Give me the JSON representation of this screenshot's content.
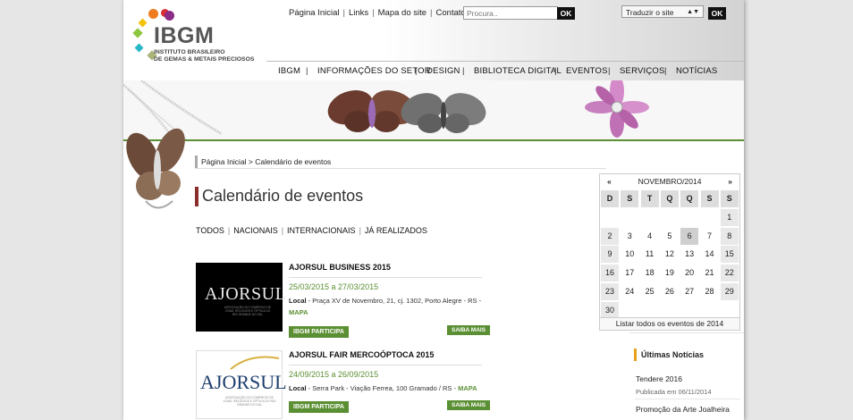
{
  "colors": {
    "brand_green": "#5b8f33",
    "title_accent": "#8a2e2e",
    "news_accent": "#e8a01c"
  },
  "logo": {
    "name": "IBGM",
    "subtitle_line1": "INSTITUTO BRASILEIRO",
    "subtitle_line2": "DE GEMAS & METAIS PRECIOSOS"
  },
  "toplinks": [
    "Página Inicial",
    "Links",
    "Mapa do site",
    "Contato"
  ],
  "search": {
    "placeholder": "Procura..",
    "button": "OK"
  },
  "translate": {
    "value": "Traduzir o site",
    "button": "OK"
  },
  "mainnav": [
    "IBGM",
    "INFORMAÇÕES DO SETOR",
    "DESIGN",
    "BIBLIOTECA DIGITAL",
    "EVENTOS",
    "SERVIÇOS",
    "NOTÍCIAS"
  ],
  "breadcrumb": {
    "home": "Página Inicial",
    "sep": " > ",
    "current": "Calendário de eventos"
  },
  "page_title": "Calendário de eventos",
  "filters": [
    "TODOS",
    "NACIONAIS",
    "INTERNACIONAIS",
    "JÁ REALIZADOS"
  ],
  "events": [
    {
      "title": "AJORSUL BUSINESS 2015",
      "date": "25/03/2015 a 27/03/2015",
      "local_label": "Local",
      "local": " - Praça XV de Novembro, 21, cj. 1302, Porto Alegre - RS - ",
      "map": "MAPA",
      "badge": "IBGM PARTICIPA",
      "more": "SAIBA MAIS",
      "logo_text": "AJORSUL",
      "logo_sub": "ASSOCIAÇÃO DO COMÉRCIO DE JOIAS, RELÓGIOS E ÓPTICA DO RIO GRANDE DO SUL"
    },
    {
      "title": "AJORSUL FAIR MERCOÓPTOCA 2015",
      "date": "24/09/2015 a 26/09/2015",
      "local_label": "Local",
      "local": " - Serra Park - Viação Ferrea, 100 Gramado / RS - ",
      "map": "MAPA",
      "badge": "IBGM PARTICIPA",
      "more": "SAIBA MAIS",
      "logo_text": "AJORSUL",
      "logo_sub": "ASSOCIAÇÃO DO COMÉRCIO DE JOIAS, RELÓGIOS E ÓPTICA DO RIO GRANDE DO SUL"
    }
  ],
  "calendar": {
    "prev": "«",
    "next": "»",
    "month": "NOVEMBRO/2014",
    "weekdays": [
      "D",
      "S",
      "T",
      "Q",
      "Q",
      "S",
      "S"
    ],
    "weeks": [
      [
        "",
        "",
        "",
        "",
        "",
        "",
        "1"
      ],
      [
        "2",
        "3",
        "4",
        "5",
        "6",
        "7",
        "8"
      ],
      [
        "9",
        "10",
        "11",
        "12",
        "13",
        "14",
        "15"
      ],
      [
        "16",
        "17",
        "18",
        "19",
        "20",
        "21",
        "22"
      ],
      [
        "23",
        "24",
        "25",
        "26",
        "27",
        "28",
        "29"
      ],
      [
        "30",
        "",
        "",
        "",
        "",
        "",
        ""
      ]
    ],
    "highlighted_day": "6",
    "footer": "Listar todos os eventos de 2014"
  },
  "news": {
    "heading": "Últimas Notícias",
    "items": [
      {
        "title": "Tendere 2016",
        "date": "Publicada em 06/11/2014"
      },
      {
        "title": "Promoção da Arte Joalheira",
        "date": ""
      }
    ]
  }
}
